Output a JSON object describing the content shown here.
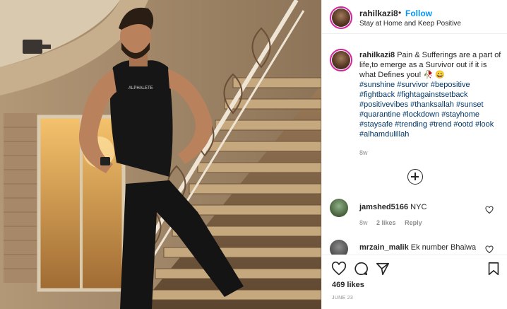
{
  "post": {
    "username": "rahilkazi8",
    "dot": "•",
    "follow_label": "Follow",
    "location": "Stay at Home and Keep Positive",
    "shirt_text": "ALPHALETE"
  },
  "caption": {
    "username": "rahilkazi8",
    "text": "Pain & Sufferings are a part of life,to emerge as a Survivor out if it is what Defines you!",
    "emoji": "🥀 😀",
    "hashtags": [
      "#sunshine",
      "#survivor",
      "#bepositive",
      "#fightback",
      "#fightagainstsetback",
      "#positivevibes",
      "#thanksallah",
      "#sunset",
      "#quarantine",
      "#lockdown",
      "#stayhome",
      "#staysafe",
      "#trending",
      "#trend",
      "#ootd",
      "#look",
      "#alhamdulillah"
    ],
    "time": "8w"
  },
  "comments": [
    {
      "username": "jamshed5166",
      "text": "NYC",
      "time": "8w",
      "likes": "2 likes",
      "reply": "Reply"
    },
    {
      "username": "mrzain_malik",
      "text": "Ek number Bhaiwa"
    }
  ],
  "actions": {
    "like_icon": "heart-icon",
    "comment_icon": "comment-icon",
    "share_icon": "share-icon",
    "save_icon": "bookmark-icon"
  },
  "likes": "469 likes",
  "date": "JUNE 23",
  "colors": {
    "link": "#0095f6",
    "hashtag": "#00376b",
    "muted": "#8e8e8e",
    "border": "#efefef"
  }
}
